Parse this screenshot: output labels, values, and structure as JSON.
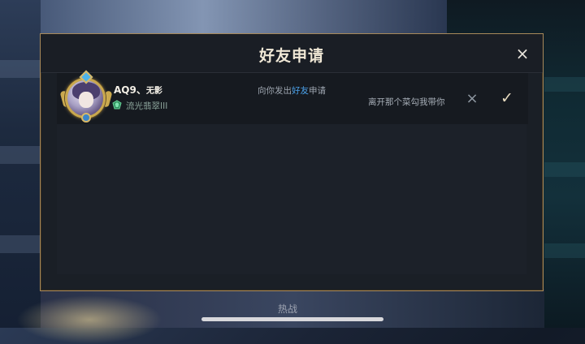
{
  "dialog": {
    "title": "好友申请",
    "close_icon": "×"
  },
  "request": {
    "player_name": "AQ9、",
    "player_name_suffix": "无影",
    "rank": "流光翡翠III",
    "request_prefix": "向你发出",
    "request_highlight": "好友",
    "request_suffix": "申请",
    "message": "离开那个菜勾我带你",
    "reject_icon": "×",
    "accept_icon": "✓"
  },
  "background": {
    "bottom_label": "热战"
  },
  "colors": {
    "accent_gold": "#a8895a",
    "highlight_blue": "#4aa0e8",
    "rank_green": "#3aa36b"
  }
}
